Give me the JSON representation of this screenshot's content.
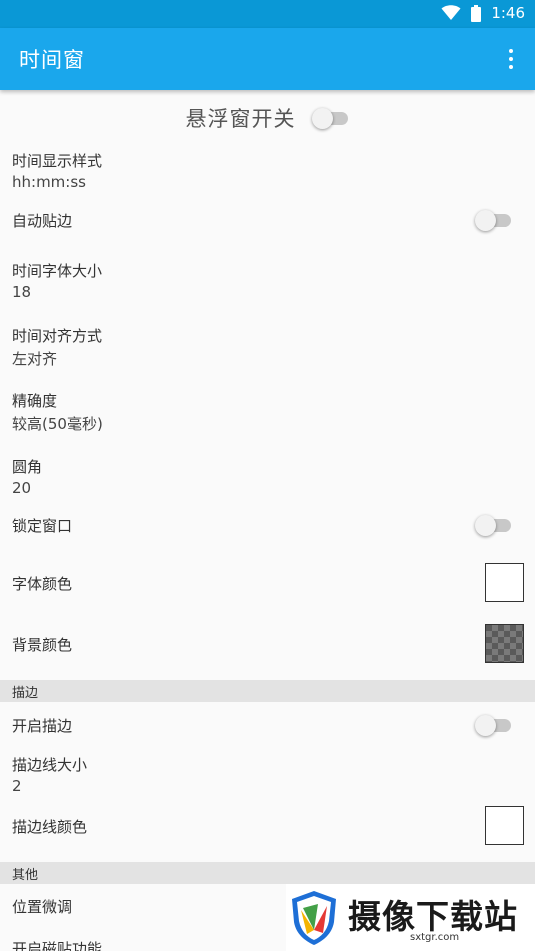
{
  "status_bar": {
    "time": "1:46",
    "wifi_icon": "wifi-icon",
    "battery_icon": "battery-icon"
  },
  "app_bar": {
    "title": "时间窗",
    "menu_icon": "more-vert-icon"
  },
  "master_switch": {
    "label": "悬浮窗开关",
    "on": false
  },
  "prefs": {
    "time_style": {
      "title": "时间显示样式",
      "value": "hh:mm:ss"
    },
    "auto_snap": {
      "title": "自动贴边",
      "on": false
    },
    "font_size": {
      "title": "时间字体大小",
      "value": "18"
    },
    "align": {
      "title": "时间对齐方式",
      "value": "左对齐"
    },
    "precision": {
      "title": "精确度",
      "value": "较高(50毫秒)"
    },
    "radius": {
      "title": "圆角",
      "value": "20"
    },
    "lock_window": {
      "title": "锁定窗口",
      "on": false
    },
    "font_color": {
      "title": "字体颜色",
      "color": "#ffffff"
    },
    "bg_color": {
      "title": "背景颜色",
      "pattern": "transparent-checker"
    }
  },
  "sections": {
    "stroke": {
      "header": "描边",
      "enable": {
        "title": "开启描边",
        "on": false
      },
      "width": {
        "title": "描边线大小",
        "value": "2"
      },
      "color": {
        "title": "描边线颜色",
        "color": "#ffffff"
      }
    },
    "other": {
      "header": "其他",
      "position_tune": {
        "title": "位置微调"
      },
      "snap_feature": {
        "title": "开启磁贴功能"
      }
    }
  },
  "watermark": {
    "text": "摄像下载站",
    "url": "sxtgr.com"
  },
  "colors": {
    "status_bar": "#0a98d6",
    "app_bar": "#1aa7ec",
    "section_bg": "#e3e3e3",
    "background": "#fafafa"
  }
}
